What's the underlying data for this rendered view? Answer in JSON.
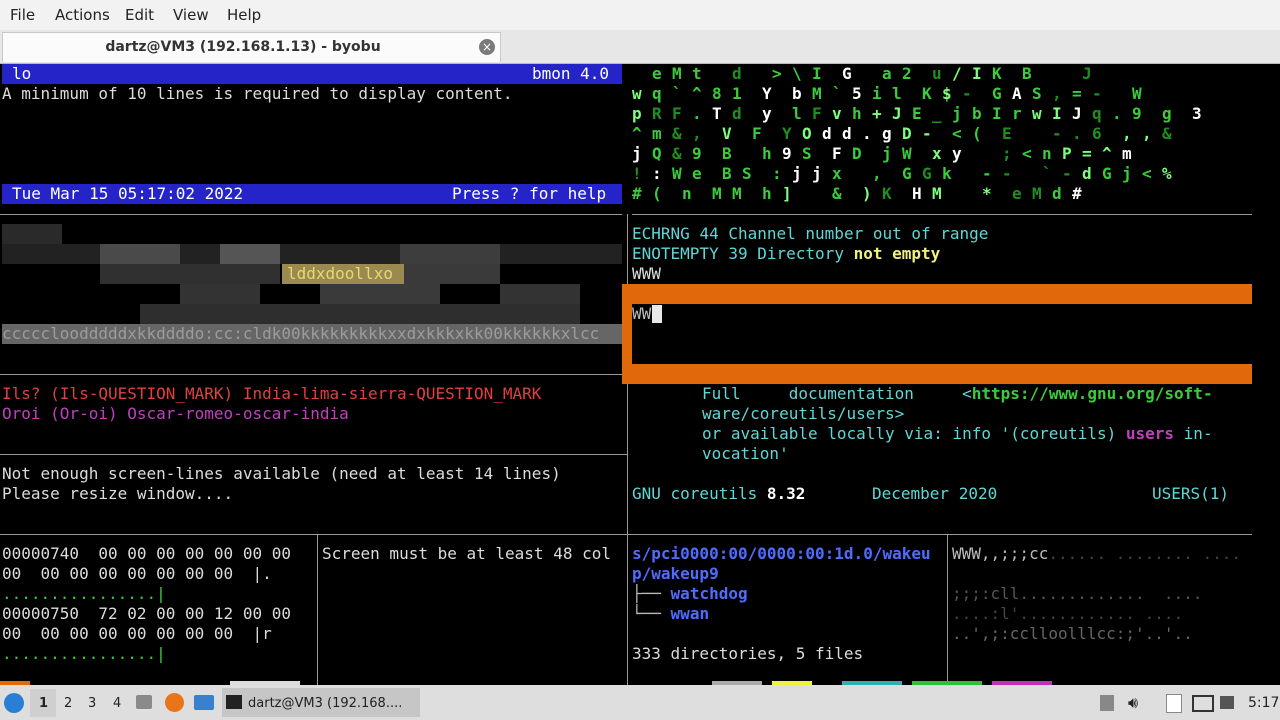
{
  "menubar": {
    "file": "File",
    "actions": "Actions",
    "edit": "Edit",
    "view": "View",
    "help": "Help"
  },
  "tab": {
    "title": "dartz@VM3 (192.168.1.13) - byobu"
  },
  "bmon": {
    "iface": "lo",
    "version": "bmon 4.0",
    "message": "A minimum of 10 lines is required to display content.",
    "datetime": "Tue Mar 15 05:17:02 2022",
    "help_hint": "Press ? for help"
  },
  "ascii_art": {
    "highlight": "lddxdoollxo",
    "bottom_line": "cccccloodddddxkkddddo:cc:cldk00kkkkkkkkkxxdxkkkxkk00kkkkkkxlcc"
  },
  "spelling": {
    "line1": "Ils? (Ils-QUESTION_MARK) India-lima-sierra-QUESTION_MARK",
    "line2": "Oroi (Or-oi) Oscar-romeo-oscar-india"
  },
  "resize": {
    "line1": "Not enough screen-lines available (need at least 14 lines)",
    "line2": "Please resize window...."
  },
  "hexdump": {
    "l1": "00000740  00 00 00 00 00 00 00",
    "l2": "00  00 00 00 00 00 00 00  |.",
    "l3": "................|",
    "l4": "00000750  72 02 00 00 12 00 00",
    "l5": "00  00 00 00 00 00 00 00  |r",
    "l6": "................|"
  },
  "screen_msg": "Screen must be at least 48 col",
  "errno": {
    "name1": "ECHRNG",
    "num1": "44",
    "desc1": "Channel number out of range",
    "name2": "ENOTEMPTY",
    "num2": "39",
    "desc2a": "Directory",
    "desc2b": "not empty",
    "www": "WWW",
    "prompt": "WW"
  },
  "manpage": {
    "doc_a": "Full",
    "doc_b": "documentation",
    "doc_c": "<",
    "url1": "https://www.gnu.org/soft-",
    "url2": "ware/coreutils/users",
    "url3": ">",
    "avail": "or available locally via: info '(coreutils)",
    "users": "users",
    "inv1": "in-",
    "inv2": "vocation'",
    "gnu": "GNU coreutils",
    "ver": "8.32",
    "date": "December 2020",
    "section": "USERS(1)"
  },
  "tree": {
    "path1": "s/pci0000:00/0000:00:1d.0/wakeu",
    "path2": "p/wakeup9",
    "item1": "watchdog",
    "item2": "wwan",
    "summary": "333 directories, 5 files",
    "branch": "├──",
    "branch_last": "└──"
  },
  "ascii2": {
    "l1a": "WWW,,;;;cc",
    "l1b": "...... ........ ....",
    "l2": ";;;:cll.............  ....",
    "l3": "....:l'............ ....",
    "l4": "..',;:cclloolllcc:;'..'.."
  },
  "taskbar": {
    "workspaces": [
      "1",
      "2",
      "3",
      "4"
    ],
    "window_title": "dartz@VM3 (192.168....",
    "clock": "5:17"
  },
  "colors": {
    "orange": "#e06a0a",
    "blue_bar": "#2424c8",
    "green": "#3acc3a",
    "magenta": "#c040c0",
    "red": "#e04040",
    "teal": "#5fd7d7",
    "link": "#4f6cff"
  },
  "icons": {
    "start": "distro-logo-icon",
    "files": "file-manager-icon",
    "browser": "firefox-icon",
    "folder": "folder-icon",
    "terminal": "terminal-icon",
    "tray": [
      "removable-drive-icon",
      "volume-icon",
      "clipboard-icon",
      "monitor-icon",
      "network-icon"
    ]
  }
}
